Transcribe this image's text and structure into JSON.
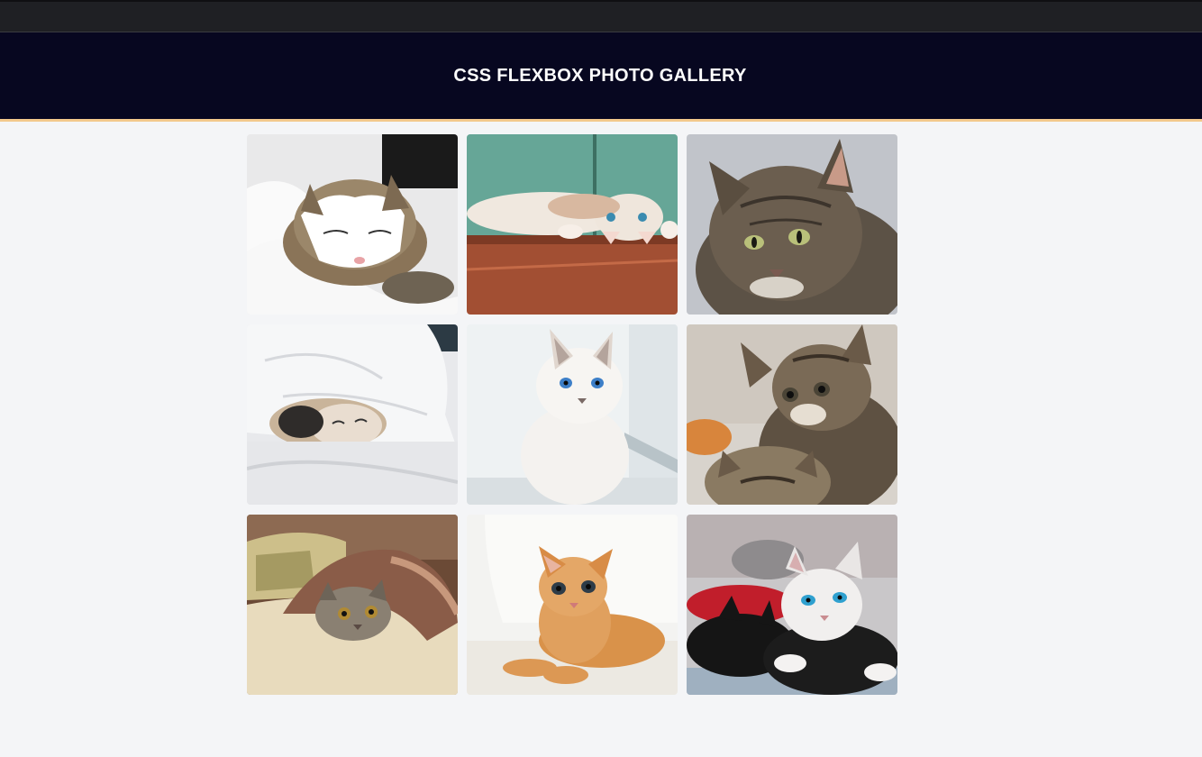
{
  "header": {
    "title": "CSS FLEXBOX PHOTO GALLERY"
  },
  "gallery": {
    "photos": [
      {
        "subject": "sleeping tabby-and-white cat on white bedding"
      },
      {
        "subject": "cream cat lying upside down on wooden floor"
      },
      {
        "subject": "grey tabby cat portrait"
      },
      {
        "subject": "kitten sleeping under white duvet"
      },
      {
        "subject": "white siamese kitten by window"
      },
      {
        "subject": "two tabby kittens"
      },
      {
        "subject": "tabby kitten under brown blanket on pillow"
      },
      {
        "subject": "ginger kitten lying on white surface"
      },
      {
        "subject": "black and white kittens on grey sofa"
      }
    ]
  },
  "colors": {
    "topbar": "#1f2024",
    "header_bg": "#070720",
    "header_border": "#f3c98c",
    "page_bg": "#f4f5f7"
  }
}
